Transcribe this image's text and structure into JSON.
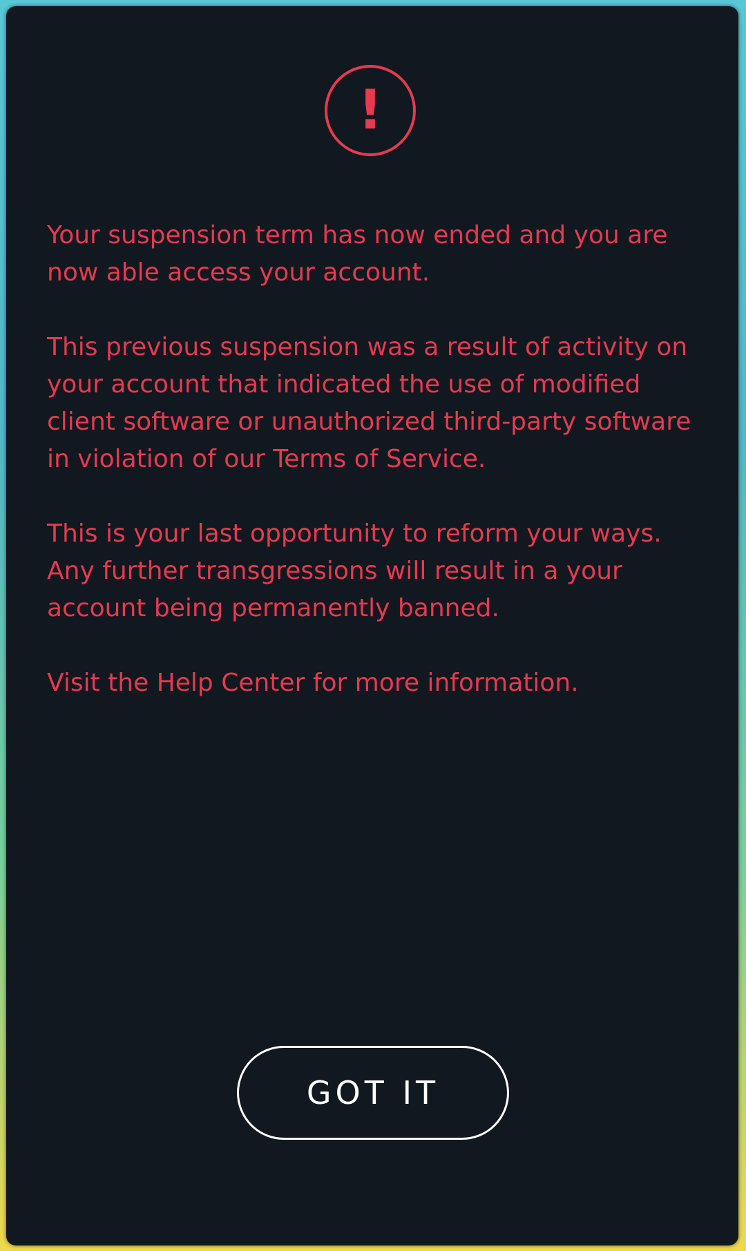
{
  "colors": {
    "dialog_bg": "#121820",
    "alert_red": "#e53a4f",
    "button_text": "#ffffff"
  },
  "alert": {
    "icon": "exclamation-circle-icon",
    "glyph": "!"
  },
  "message": {
    "paragraph1": "Your suspension term has now ended and you are now able access your account.",
    "paragraph2": "This previous suspension was a result of activity on your account that indicated the use of modified client software or unauthorized third-party software in violation of our Terms of Service.",
    "paragraph3": "This is your last opportunity to reform your ways. Any further transgressions will result in a your account being permanently banned.",
    "paragraph4_prefix": "Visit the ",
    "help_link": "Help Center",
    "paragraph4_suffix": " for more information."
  },
  "actions": {
    "got_it_label": "GOT IT"
  }
}
